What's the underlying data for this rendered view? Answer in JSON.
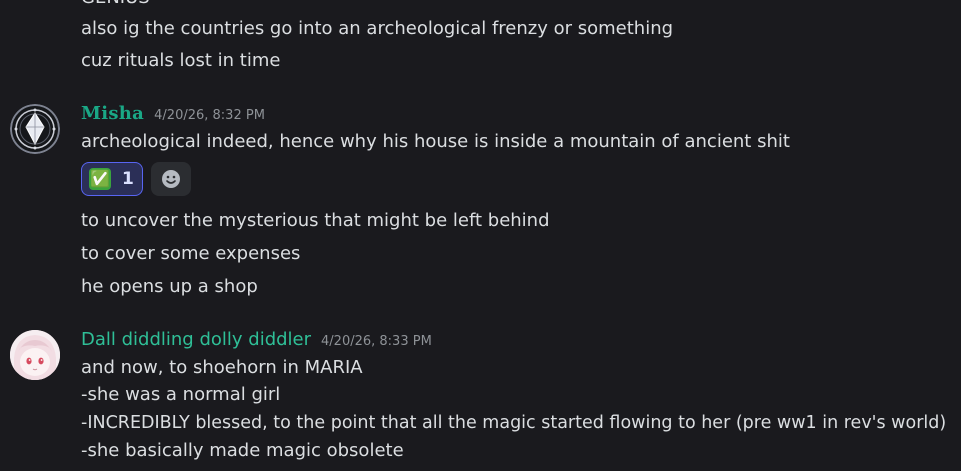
{
  "partial_top": {
    "text": "GENIUS"
  },
  "group1": {
    "lines": [
      "also ig the countries go into an archeological frenzy or something",
      "cuz rituals lost in time"
    ]
  },
  "message_misha": {
    "username": "Misha",
    "timestamp": "4/20/26, 8:32 PM",
    "text": "archeological indeed, hence why his house is inside a mountain of ancient shit",
    "reaction": {
      "emoji": "✅",
      "count": "1"
    },
    "followups": [
      "to uncover the mysterious that might be left behind",
      "to cover some expenses",
      "he opens up a shop"
    ]
  },
  "message_dall": {
    "username": "Dall diddling dolly diddler",
    "timestamp": "4/20/26, 8:33 PM",
    "lines": [
      "and now, to shoehorn in MARIA",
      "-she was a normal girl",
      "-INCREDIBLY blessed, to the point that all the magic started flowing to her (pre ww1 in rev's world)",
      "-she basically made magic obsolete"
    ]
  },
  "colors": {
    "background": "#1a1a1e",
    "text": "#dbdee1",
    "username_misha": "#1aa886",
    "username_dall": "#2fbf97",
    "timestamp": "#8e9297",
    "reaction_border": "#5865f2"
  },
  "icons": {
    "misha_avatar": "crystal-emblem-avatar",
    "dall_avatar": "anime-girl-avatar",
    "add_reaction": "smiley-add-reaction-icon"
  }
}
